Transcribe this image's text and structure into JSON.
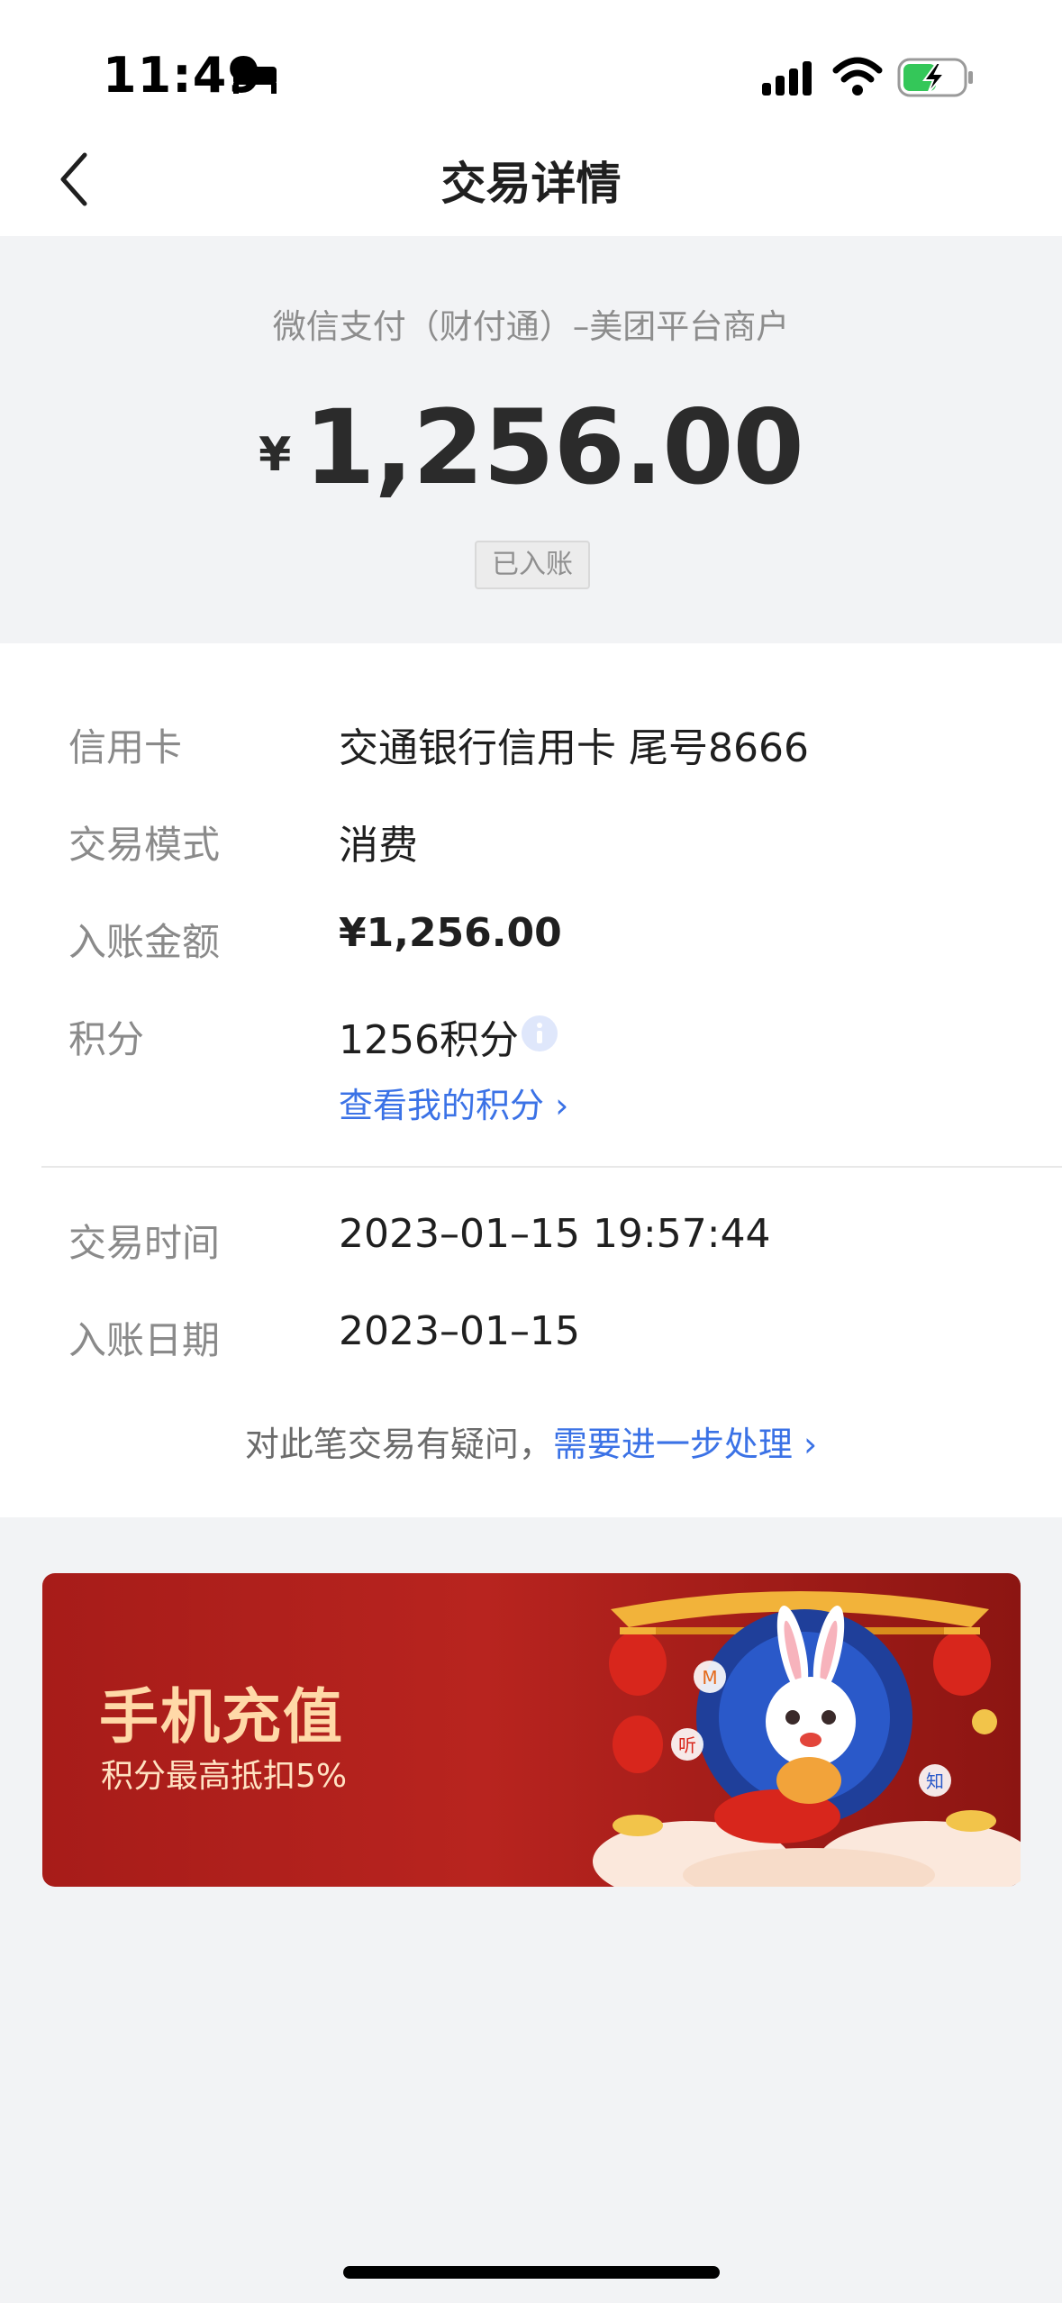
{
  "status_bar": {
    "time": "11:49",
    "icons": [
      "bed-icon",
      "signal-icon",
      "wifi-icon",
      "battery-charging-icon"
    ]
  },
  "nav": {
    "title": "交易详情",
    "back_icon": "back-chevron-icon"
  },
  "summary": {
    "merchant": "微信支付（财付通）–美团平台商户",
    "currency_symbol": "¥",
    "amount": "1,256.00",
    "status": "已入账"
  },
  "details": {
    "rows": [
      {
        "label": "信用卡",
        "value": "交通银行信用卡 尾号8666"
      },
      {
        "label": "交易模式",
        "value": "消费"
      },
      {
        "label": "入账金额",
        "value": "¥1,256.00"
      },
      {
        "label": "积分",
        "value": "1256积分"
      }
    ],
    "points_link": "查看我的积分",
    "time_rows": [
      {
        "label": "交易时间",
        "value": "2023–01–15 19:57:44"
      },
      {
        "label": "入账日期",
        "value": "2023–01–15"
      }
    ],
    "question_text": "对此笔交易有疑问，",
    "question_link": "需要进一步处理"
  },
  "banner": {
    "title": "手机充值",
    "subtitle": "积分最高抵扣5%",
    "art_items": [
      "听",
      "知",
      "M"
    ]
  },
  "colors": {
    "link": "#3b72e6",
    "banner_bg": "#b8241f",
    "banner_title": "#ffd9a8"
  }
}
